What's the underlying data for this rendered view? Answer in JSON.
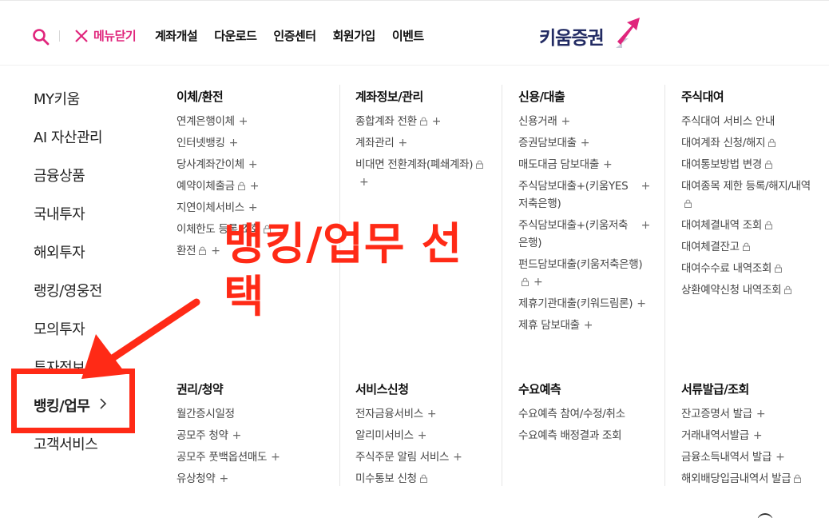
{
  "header": {
    "close_label": "메뉴닫기",
    "nav": [
      "계좌개설",
      "다운로드",
      "인증센터",
      "회원가입",
      "이벤트"
    ],
    "logo_text": "키움증권",
    "accent_color": "#e0257c",
    "brand_color": "#222b63"
  },
  "left_menu": {
    "items": [
      "MY키움",
      "AI 자산관리",
      "금융상품",
      "국내투자",
      "해외투자",
      "랭킹/영웅전",
      "모의투자",
      "투자정보",
      "뱅킹/업무",
      "고객서비스"
    ],
    "active": "뱅킹/업무"
  },
  "sections": {
    "transfer": {
      "title": "이체/환전",
      "items": [
        {
          "label": "연계은행이체",
          "lock": false,
          "plus": true
        },
        {
          "label": "인터넷뱅킹",
          "lock": false,
          "plus": true
        },
        {
          "label": "당사계좌간이체",
          "lock": false,
          "plus": true
        },
        {
          "label": "예약이체출금",
          "lock": true,
          "plus": true
        },
        {
          "label": "지연이체서비스",
          "lock": false,
          "plus": true
        },
        {
          "label": "이체한도 등록/조회",
          "lock": true,
          "plus": false
        },
        {
          "label": "환전",
          "lock": true,
          "plus": true
        }
      ]
    },
    "account": {
      "title": "계좌정보/관리",
      "items": [
        {
          "label": "종합계좌 전환",
          "lock": true,
          "plus": true
        },
        {
          "label": "계좌관리",
          "lock": false,
          "plus": true
        },
        {
          "label": "비대면 전환계좌(폐쇄계좌)",
          "lock": true,
          "plus": true
        }
      ]
    },
    "credit": {
      "title": "신용/대출",
      "items": [
        {
          "label": "신용거래",
          "lock": false,
          "plus": true
        },
        {
          "label": "증권담보대출",
          "lock": false,
          "plus": true
        },
        {
          "label": "매도대금 담보대출",
          "lock": false,
          "plus": true
        },
        {
          "label": "주식담보대출+(키움YES 저축은행)",
          "lock": false,
          "plus": true
        },
        {
          "label": "주식담보대출+(키움저축은행)",
          "lock": false,
          "plus": true
        },
        {
          "label": "펀드담보대출(키움저축은행)",
          "lock": true,
          "plus": true
        },
        {
          "label": "제휴기관대출(키워드림론)",
          "lock": false,
          "plus": true
        },
        {
          "label": "제휴 담보대출",
          "lock": false,
          "plus": true
        }
      ]
    },
    "lending": {
      "title": "주식대여",
      "items": [
        {
          "label": "주식대여 서비스 안내",
          "lock": false,
          "plus": false
        },
        {
          "label": "대여계좌 신청/해지",
          "lock": true,
          "plus": false
        },
        {
          "label": "대여통보방법 변경",
          "lock": true,
          "plus": false
        },
        {
          "label": "대여종목 제한 등록/해지/내역",
          "lock": true,
          "plus": false
        },
        {
          "label": "대여체결내역 조회",
          "lock": true,
          "plus": false
        },
        {
          "label": "대여체결잔고",
          "lock": true,
          "plus": false
        },
        {
          "label": "대여수수료 내역조회",
          "lock": true,
          "plus": false
        },
        {
          "label": "상환예약신청 내역조회",
          "lock": true,
          "plus": false
        }
      ]
    },
    "rights": {
      "title": "권리/청약",
      "items": [
        {
          "label": "월간증시일정",
          "lock": false,
          "plus": false
        },
        {
          "label": "공모주 청약",
          "lock": false,
          "plus": true
        },
        {
          "label": "공모주 풋백옵션매도",
          "lock": false,
          "plus": true
        },
        {
          "label": "유상청약",
          "lock": false,
          "plus": true
        }
      ]
    },
    "service": {
      "title": "서비스신청",
      "items": [
        {
          "label": "전자금융서비스",
          "lock": false,
          "plus": true
        },
        {
          "label": "알리미서비스",
          "lock": false,
          "plus": true
        },
        {
          "label": "주식주문 알림 서비스",
          "lock": false,
          "plus": true
        },
        {
          "label": "미수통보 신청",
          "lock": true,
          "plus": false
        }
      ]
    },
    "demand": {
      "title": "수요예측",
      "items": [
        {
          "label": "수요예측 참여/수정/취소",
          "lock": false,
          "plus": false
        },
        {
          "label": "수요예측 배정결과 조회",
          "lock": false,
          "plus": false
        }
      ]
    },
    "docs": {
      "title": "서류발급/조회",
      "items": [
        {
          "label": "잔고증명서 발급",
          "lock": false,
          "plus": true
        },
        {
          "label": "거래내역서발급",
          "lock": false,
          "plus": true
        },
        {
          "label": "금융소득내역서 발급",
          "lock": false,
          "plus": true
        },
        {
          "label": "해외배당입금내역서 발급",
          "lock": true,
          "plus": false
        }
      ]
    }
  },
  "annotation": {
    "text_line1": "뱅킹/업무 선",
    "text_line2": "택",
    "color": "#ff2a16"
  }
}
